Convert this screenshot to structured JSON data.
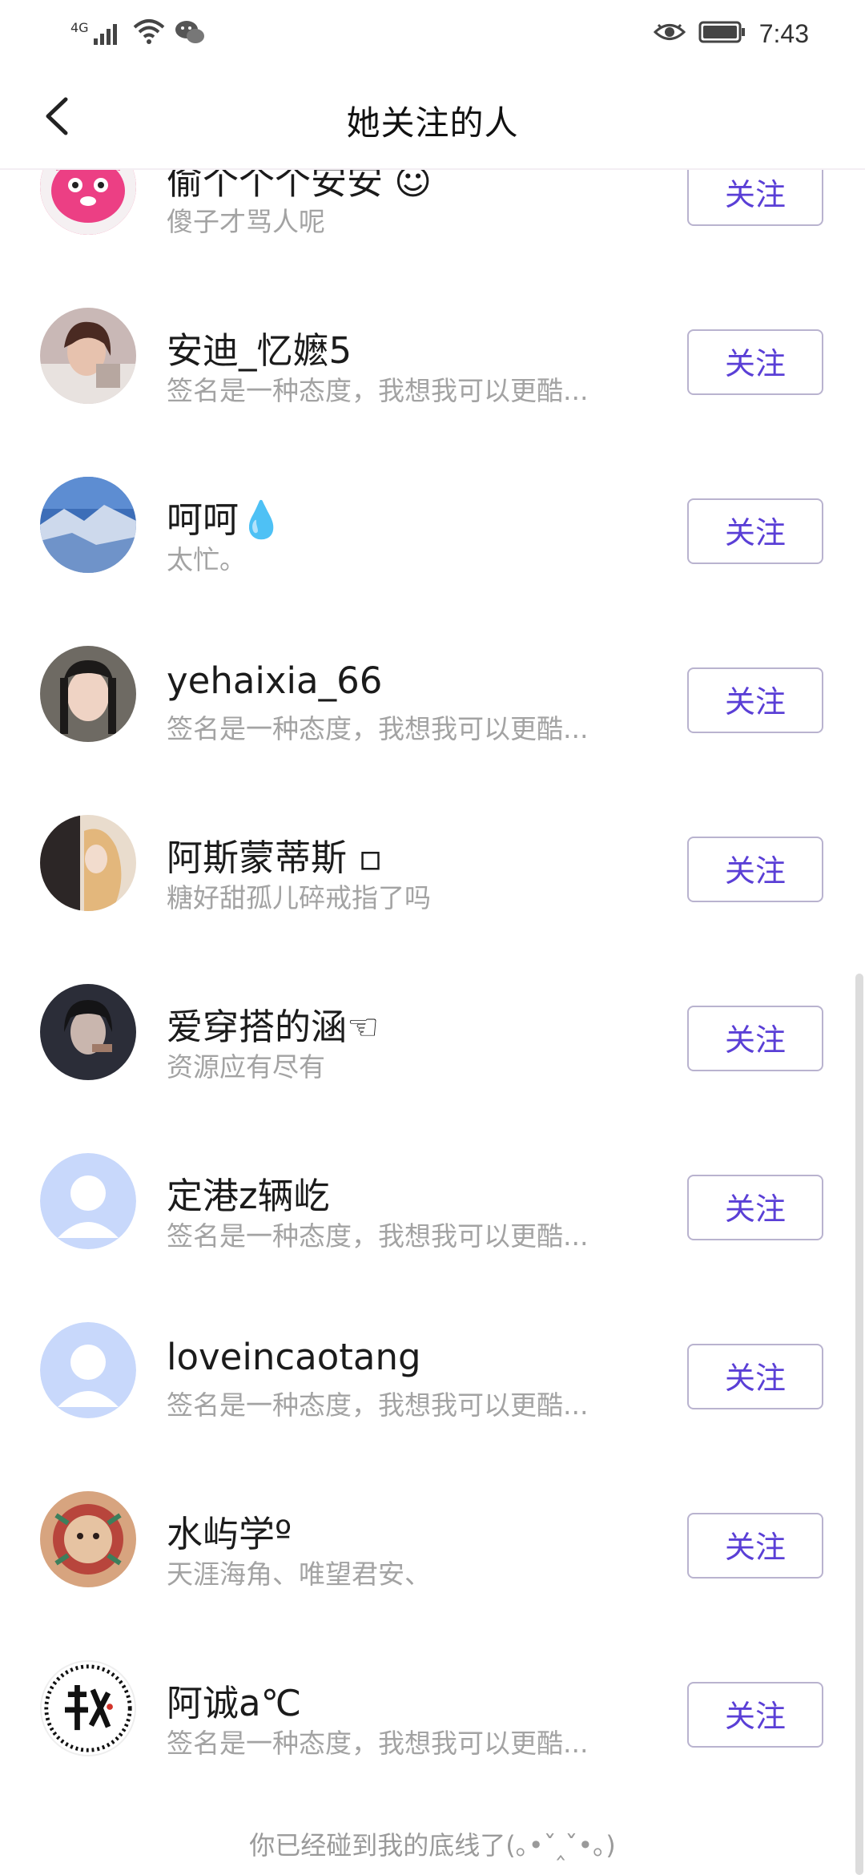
{
  "status_bar": {
    "network": "4G",
    "time": "7:43",
    "icons": [
      "signal-icon",
      "wifi-icon",
      "wechat-icon",
      "eye-icon",
      "battery-icon"
    ]
  },
  "nav": {
    "title": "她关注的人",
    "back_icon": "chevron-left-icon"
  },
  "users": [
    {
      "name": "偷个个个安安 ☺",
      "signature": "傻子才骂人呢",
      "button": "关注",
      "avatar": "pink-cartoon"
    },
    {
      "name": "安迪_忆嬷5",
      "signature": "签名是一种态度，我想我可以更酷...",
      "button": "关注",
      "avatar": "photo-woman"
    },
    {
      "name": "呵呵💧",
      "signature": "太忙。",
      "button": "关注",
      "avatar": "photo-glacier"
    },
    {
      "name": "yehaixia_66",
      "signature": "签名是一种态度，我想我可以更酷...",
      "button": "关注",
      "avatar": "photo-woman-2"
    },
    {
      "name": "阿斯蒙蒂斯 ▫",
      "signature": "糖好甜孤儿碎戒指了吗",
      "button": "关注",
      "avatar": "photo-illustration"
    },
    {
      "name": "爱穿搭的涵☜",
      "signature": "资源应有尽有",
      "button": "关注",
      "avatar": "photo-dark"
    },
    {
      "name": "定港z辆屹",
      "signature": "签名是一种态度，我想我可以更酷...",
      "button": "关注",
      "avatar": "default"
    },
    {
      "name": "loveincaotang",
      "signature": "签名是一种态度，我想我可以更酷...",
      "button": "关注",
      "avatar": "default"
    },
    {
      "name": "水屿学º",
      "signature": "天涯海角、唯望君安、",
      "button": "关注",
      "avatar": "photo-art"
    },
    {
      "name": "阿诚a℃",
      "signature": "签名是一种态度，我想我可以更酷...",
      "button": "关注",
      "avatar": "calligraphy"
    }
  ],
  "footer": "你已经碰到我的底线了(｡•ˇ‸ˇ•｡)"
}
